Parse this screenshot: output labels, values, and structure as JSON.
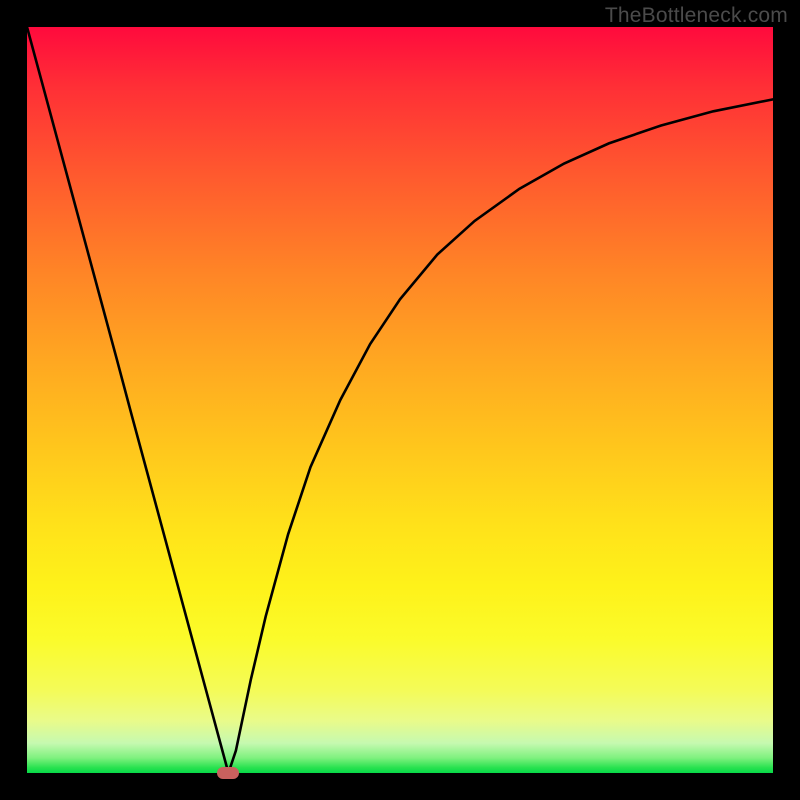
{
  "watermark": "TheBottleneck.com",
  "chart_data": {
    "type": "line",
    "title": "",
    "xlabel": "",
    "ylabel": "",
    "xlim": [
      0,
      100
    ],
    "ylim": [
      0,
      100
    ],
    "x": [
      0,
      2,
      4,
      6,
      8,
      10,
      12,
      14,
      16,
      18,
      20,
      22,
      24,
      26,
      27,
      28,
      30,
      32,
      35,
      38,
      42,
      46,
      50,
      55,
      60,
      66,
      72,
      78,
      85,
      92,
      100
    ],
    "values": [
      100,
      92.6,
      85.2,
      77.8,
      70.4,
      63.0,
      55.6,
      48.1,
      40.7,
      33.3,
      25.9,
      18.5,
      11.1,
      3.7,
      0.0,
      3.0,
      12.5,
      21.0,
      32.0,
      41.0,
      50.0,
      57.5,
      63.5,
      69.5,
      74.0,
      78.3,
      81.7,
      84.4,
      86.8,
      88.7,
      90.3
    ],
    "marker": {
      "x": 27,
      "y": 0
    },
    "background_gradient": {
      "top": "#ff0a3d",
      "bottom": "#06d948"
    }
  }
}
